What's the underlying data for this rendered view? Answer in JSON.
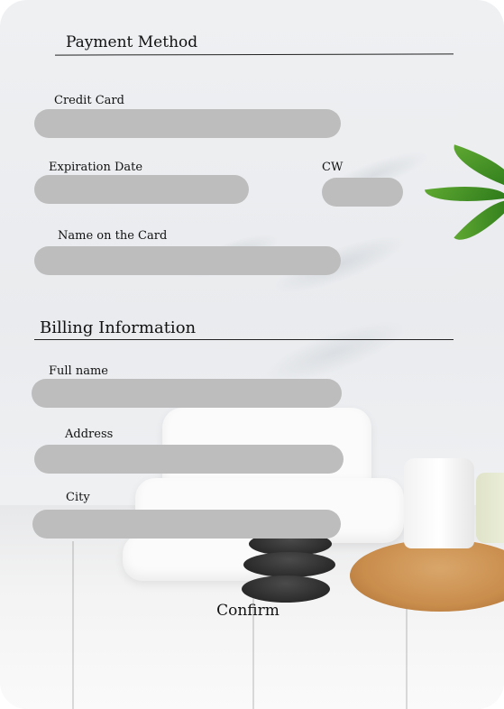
{
  "payment": {
    "title": "Payment Method",
    "credit_card_label": "Credit Card",
    "credit_card_value": "",
    "expiration_label": "Expiration Date",
    "expiration_value": "",
    "cvv_label": "CW",
    "cvv_value": "",
    "name_label": "Name on the Card",
    "name_value": ""
  },
  "billing": {
    "title": "Billing Information",
    "full_name_label": "Full name",
    "full_name_value": "",
    "address_label": "Address",
    "address_value": "",
    "city_label": "City",
    "city_value": ""
  },
  "actions": {
    "confirm_label": "Confirm"
  },
  "colors": {
    "field_bg": "#bdbdbd",
    "text": "#111111",
    "leaf": "#3f8f24"
  }
}
